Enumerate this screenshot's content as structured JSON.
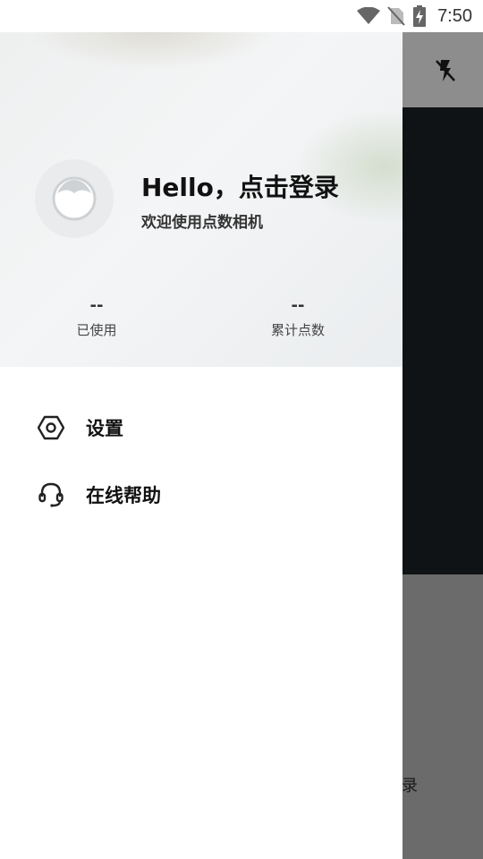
{
  "status_bar": {
    "time": "7:50",
    "icons": [
      "wifi-icon",
      "no-sim-icon",
      "battery-charging-icon"
    ]
  },
  "drawer": {
    "avatar_icon": "default-avatar-icon",
    "title": "Hello，点击登录",
    "subtitle": "欢迎使用点数相机",
    "stats": {
      "used": {
        "value": "--",
        "label": "已使用"
      },
      "total_points": {
        "value": "--",
        "label": "累计点数"
      }
    },
    "menu": [
      {
        "label": "设置",
        "icon": "settings-icon"
      },
      {
        "label": "在线帮助",
        "icon": "headset-icon"
      }
    ]
  },
  "background": {
    "flash_icon": "flash-off-icon",
    "partial_text": "录"
  },
  "colors": {
    "toolbar": "#8d8d8d",
    "preview": "#101315",
    "bottom_panel": "#6b6b6b",
    "drawer_bg": "#ffffff"
  }
}
